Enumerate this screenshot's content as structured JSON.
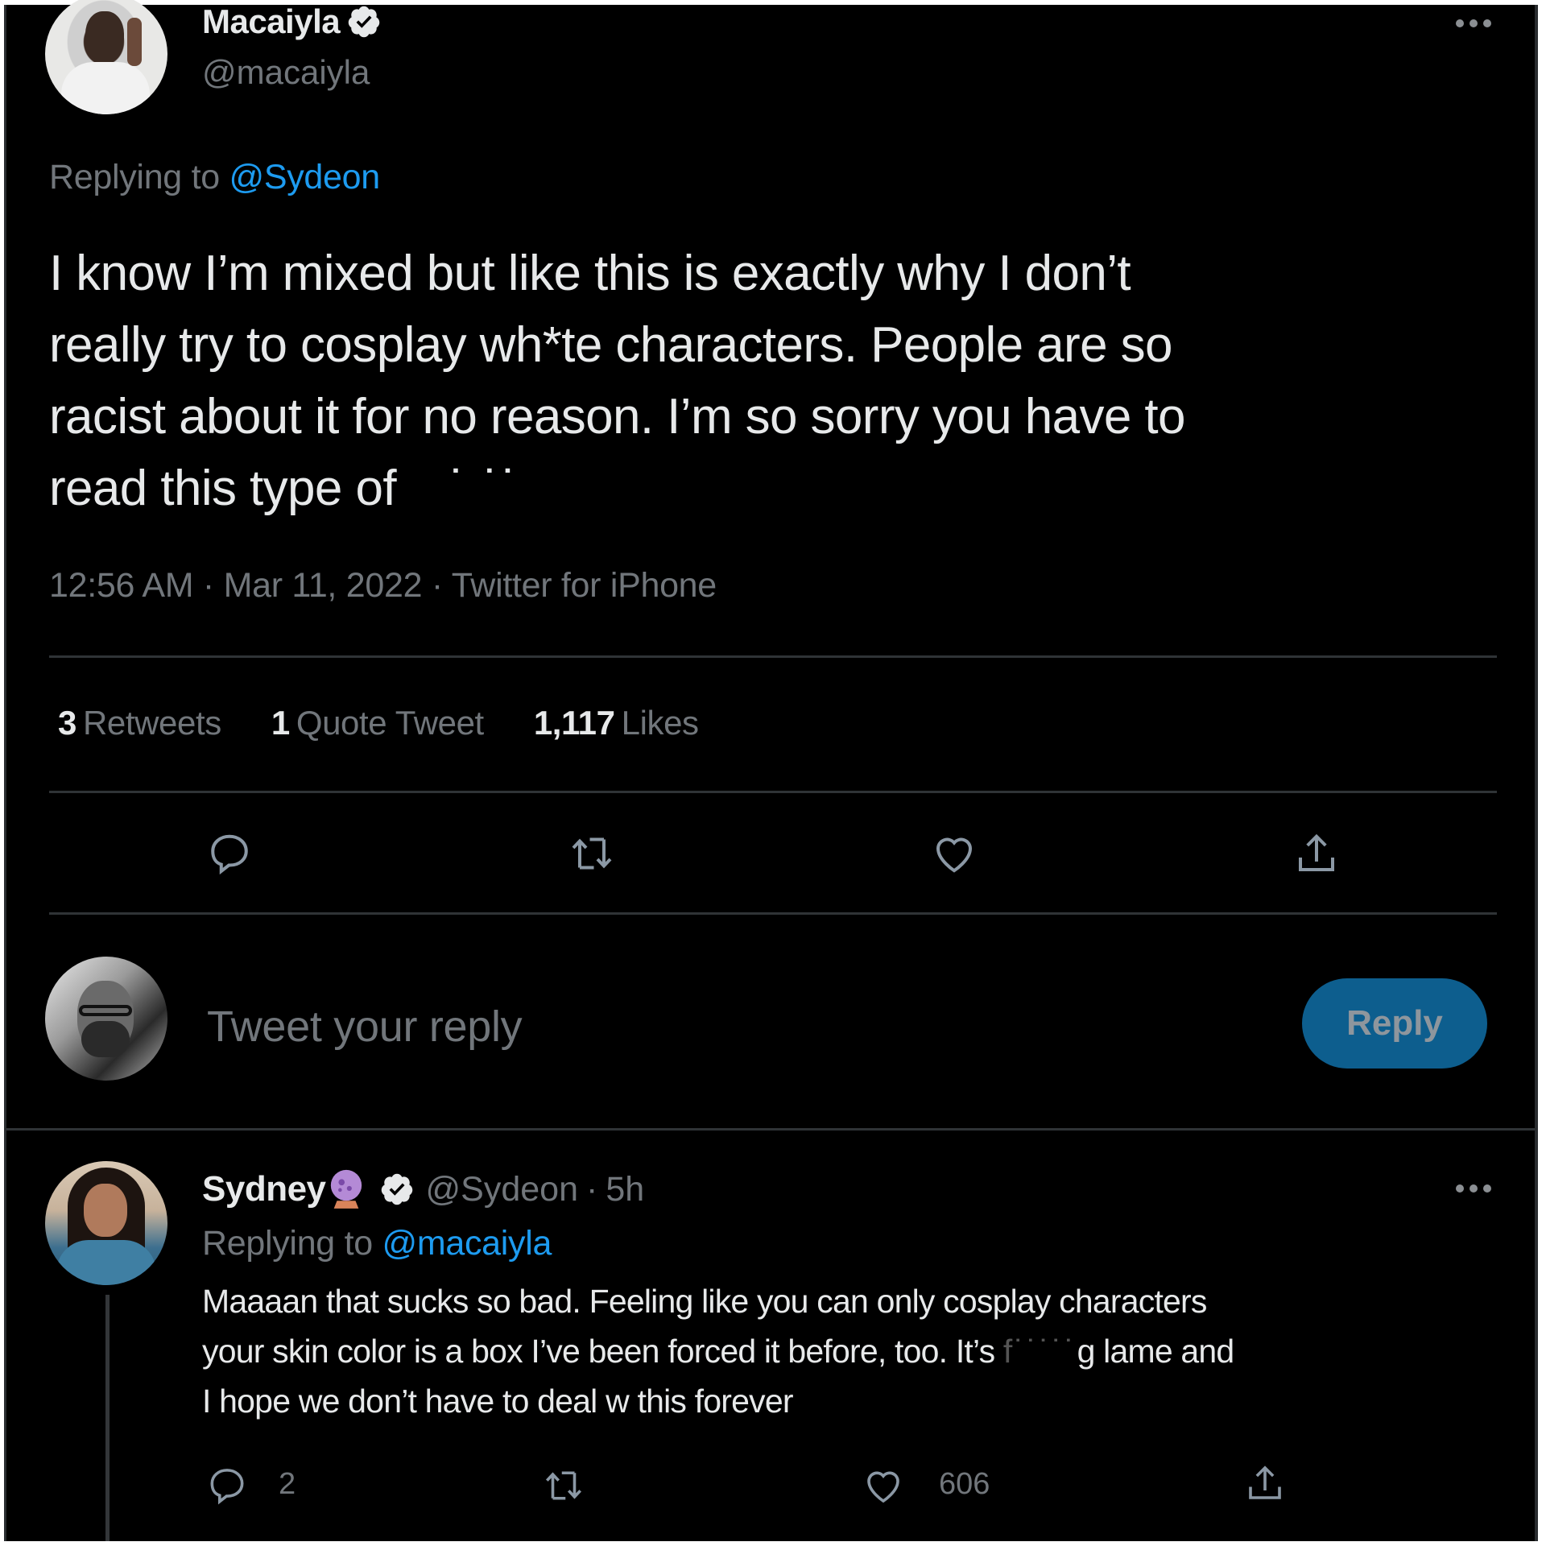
{
  "main_tweet": {
    "author": {
      "display_name": "Macaiyla",
      "handle": "@macaiyla",
      "verified": true,
      "avatar": "avatar-photo"
    },
    "replying_to_label": "Replying to",
    "replying_to_handle": "@Sydeon",
    "text_lines": [
      "I know I’m mixed but like this is exactly why I don’t",
      "really try to cosplay wh*te characters. People are so",
      "racist about it for no reason. I’m so sorry you have to",
      "read this type of"
    ],
    "censored_word": "˙ ˙˙",
    "timestamp": "12:56 AM · Mar 11, 2022 · Twitter for iPhone",
    "stats": {
      "retweets_count": "3",
      "retweets_label": "Retweets",
      "quote_count": "1",
      "quote_label": "Quote Tweet",
      "likes_count": "1,117",
      "likes_label": "Likes"
    },
    "actions": [
      "reply-icon",
      "retweet-icon",
      "like-icon",
      "share-icon"
    ],
    "more_icon": "more-horizontal-icon"
  },
  "composer": {
    "placeholder": "Tweet your reply",
    "value": "",
    "reply_button_label": "Reply"
  },
  "reply_tweet": {
    "author": {
      "display_name": "Sydney",
      "emoji": "crystal-ball",
      "handle": "@Sydeon",
      "verified": true,
      "time_ago": "5h"
    },
    "separator": "·",
    "replying_to_label": "Replying to",
    "replying_to_handle": "@macaiyla",
    "text_lines": [
      "Maaaan that sucks so bad. Feeling like you can only cosplay characters",
      "your skin color is a box I’ve been forced it before, too. It’s",
      "I hope we don’t have to deal w this forever"
    ],
    "censored_word": "f˙˙˙˙˙",
    "line2_tail": "g lame and",
    "reply_count": "2",
    "retweet_count": "",
    "like_count": "606"
  },
  "colors": {
    "background": "#000000",
    "text": "#e7e9ea",
    "muted": "#71767b",
    "link": "#1d9bf0",
    "divider": "#2f3336",
    "reply_button_bg": "#0d5e8e"
  }
}
